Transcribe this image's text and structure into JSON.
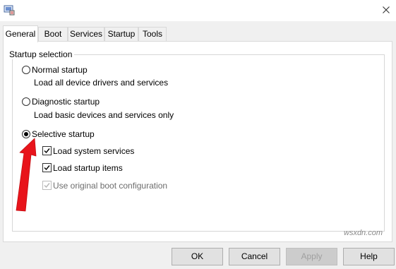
{
  "titlebar": {
    "close_glyph": "✕",
    "app_icon": "msconfig-icon"
  },
  "tabs": [
    {
      "label": "General",
      "active": true
    },
    {
      "label": "Boot",
      "active": false
    },
    {
      "label": "Services",
      "active": false
    },
    {
      "label": "Startup",
      "active": false
    },
    {
      "label": "Tools",
      "active": false
    }
  ],
  "startup_selection": {
    "title": "Startup selection",
    "options": [
      {
        "label": "Normal startup",
        "description": "Load all device drivers and services",
        "selected": false
      },
      {
        "label": "Diagnostic startup",
        "description": "Load basic devices and services only",
        "selected": false
      },
      {
        "label": "Selective startup",
        "selected": true
      }
    ],
    "checkboxes": [
      {
        "label": "Load system services",
        "checked": true,
        "enabled": true
      },
      {
        "label": "Load startup items",
        "checked": true,
        "enabled": true
      },
      {
        "label": "Use original boot configuration",
        "checked": true,
        "enabled": false
      }
    ]
  },
  "buttons": {
    "ok": "OK",
    "cancel": "Cancel",
    "apply": "Apply",
    "help": "Help"
  },
  "watermark": "wsxdn.com",
  "colors": {
    "annotation_arrow": "#e8141b"
  }
}
